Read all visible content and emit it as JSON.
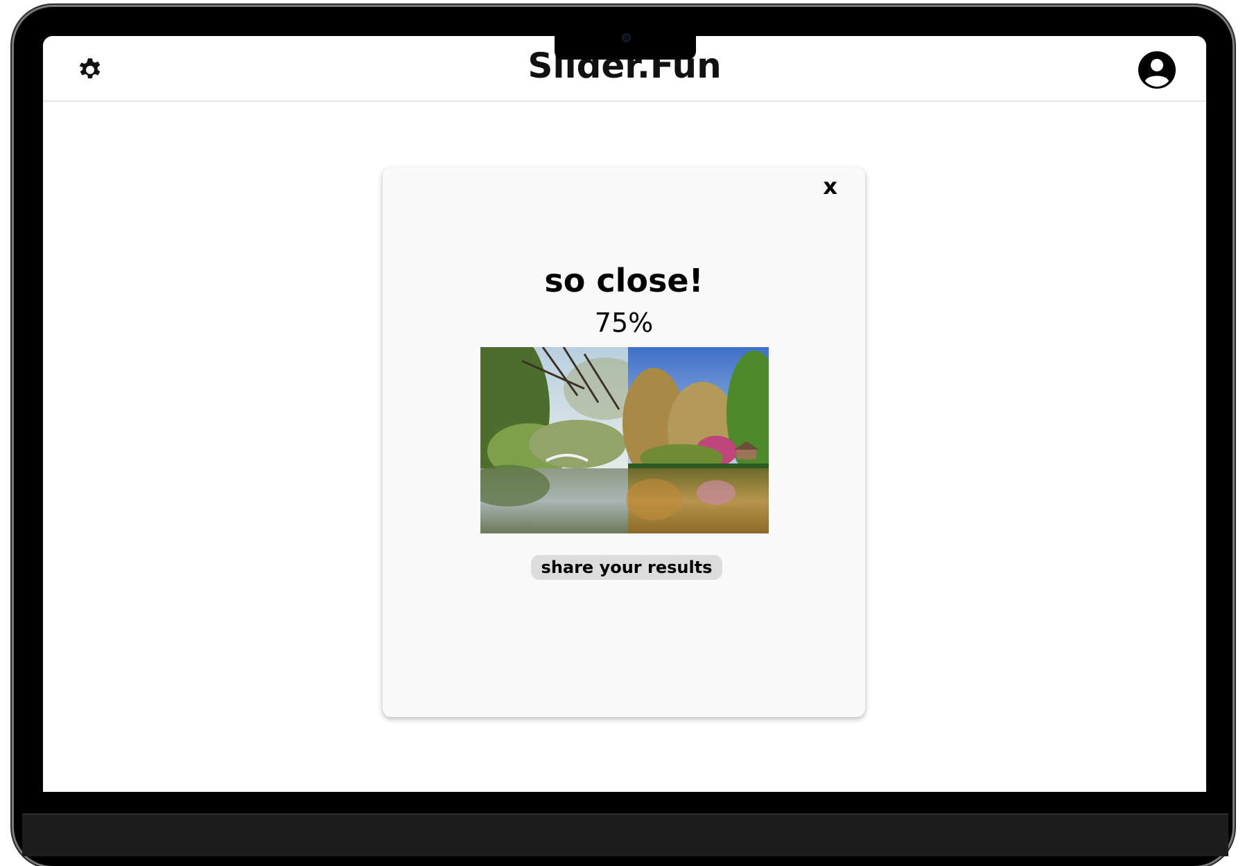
{
  "app": {
    "title": "Slider.Fun"
  },
  "icons": {
    "settings": "gear-icon",
    "profile": "user-circle-icon",
    "close": "close-icon"
  },
  "result_modal": {
    "close_label": "x",
    "heading": "so close!",
    "score": "75%",
    "share_label": "share your results"
  },
  "colors": {
    "modal_background": "#f9f9f9",
    "share_button": "#dcdcdc",
    "bezel": "#000000"
  }
}
